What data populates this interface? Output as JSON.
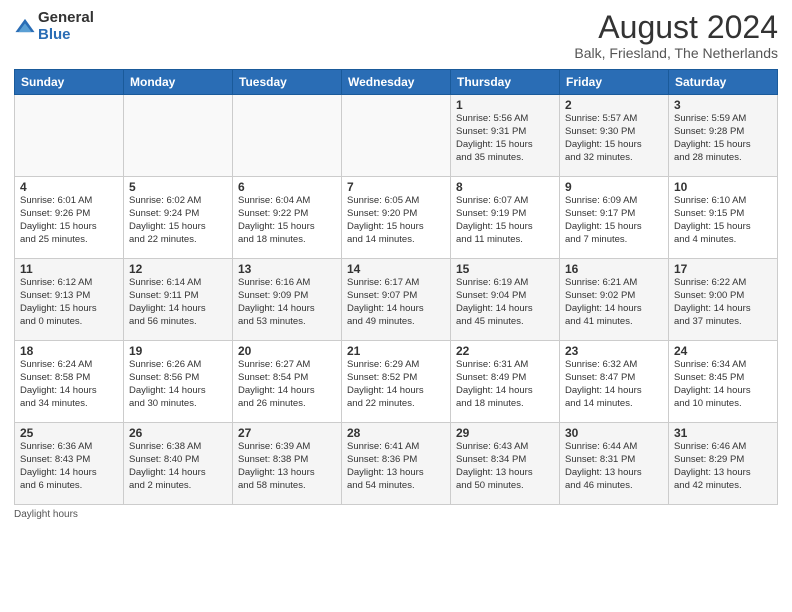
{
  "logo": {
    "general": "General",
    "blue": "Blue"
  },
  "header": {
    "month_year": "August 2024",
    "location": "Balk, Friesland, The Netherlands"
  },
  "days_of_week": [
    "Sunday",
    "Monday",
    "Tuesday",
    "Wednesday",
    "Thursday",
    "Friday",
    "Saturday"
  ],
  "weeks": [
    [
      {
        "day": "",
        "detail": ""
      },
      {
        "day": "",
        "detail": ""
      },
      {
        "day": "",
        "detail": ""
      },
      {
        "day": "",
        "detail": ""
      },
      {
        "day": "1",
        "detail": "Sunrise: 5:56 AM\nSunset: 9:31 PM\nDaylight: 15 hours\nand 35 minutes."
      },
      {
        "day": "2",
        "detail": "Sunrise: 5:57 AM\nSunset: 9:30 PM\nDaylight: 15 hours\nand 32 minutes."
      },
      {
        "day": "3",
        "detail": "Sunrise: 5:59 AM\nSunset: 9:28 PM\nDaylight: 15 hours\nand 28 minutes."
      }
    ],
    [
      {
        "day": "4",
        "detail": "Sunrise: 6:01 AM\nSunset: 9:26 PM\nDaylight: 15 hours\nand 25 minutes."
      },
      {
        "day": "5",
        "detail": "Sunrise: 6:02 AM\nSunset: 9:24 PM\nDaylight: 15 hours\nand 22 minutes."
      },
      {
        "day": "6",
        "detail": "Sunrise: 6:04 AM\nSunset: 9:22 PM\nDaylight: 15 hours\nand 18 minutes."
      },
      {
        "day": "7",
        "detail": "Sunrise: 6:05 AM\nSunset: 9:20 PM\nDaylight: 15 hours\nand 14 minutes."
      },
      {
        "day": "8",
        "detail": "Sunrise: 6:07 AM\nSunset: 9:19 PM\nDaylight: 15 hours\nand 11 minutes."
      },
      {
        "day": "9",
        "detail": "Sunrise: 6:09 AM\nSunset: 9:17 PM\nDaylight: 15 hours\nand 7 minutes."
      },
      {
        "day": "10",
        "detail": "Sunrise: 6:10 AM\nSunset: 9:15 PM\nDaylight: 15 hours\nand 4 minutes."
      }
    ],
    [
      {
        "day": "11",
        "detail": "Sunrise: 6:12 AM\nSunset: 9:13 PM\nDaylight: 15 hours\nand 0 minutes."
      },
      {
        "day": "12",
        "detail": "Sunrise: 6:14 AM\nSunset: 9:11 PM\nDaylight: 14 hours\nand 56 minutes."
      },
      {
        "day": "13",
        "detail": "Sunrise: 6:16 AM\nSunset: 9:09 PM\nDaylight: 14 hours\nand 53 minutes."
      },
      {
        "day": "14",
        "detail": "Sunrise: 6:17 AM\nSunset: 9:07 PM\nDaylight: 14 hours\nand 49 minutes."
      },
      {
        "day": "15",
        "detail": "Sunrise: 6:19 AM\nSunset: 9:04 PM\nDaylight: 14 hours\nand 45 minutes."
      },
      {
        "day": "16",
        "detail": "Sunrise: 6:21 AM\nSunset: 9:02 PM\nDaylight: 14 hours\nand 41 minutes."
      },
      {
        "day": "17",
        "detail": "Sunrise: 6:22 AM\nSunset: 9:00 PM\nDaylight: 14 hours\nand 37 minutes."
      }
    ],
    [
      {
        "day": "18",
        "detail": "Sunrise: 6:24 AM\nSunset: 8:58 PM\nDaylight: 14 hours\nand 34 minutes."
      },
      {
        "day": "19",
        "detail": "Sunrise: 6:26 AM\nSunset: 8:56 PM\nDaylight: 14 hours\nand 30 minutes."
      },
      {
        "day": "20",
        "detail": "Sunrise: 6:27 AM\nSunset: 8:54 PM\nDaylight: 14 hours\nand 26 minutes."
      },
      {
        "day": "21",
        "detail": "Sunrise: 6:29 AM\nSunset: 8:52 PM\nDaylight: 14 hours\nand 22 minutes."
      },
      {
        "day": "22",
        "detail": "Sunrise: 6:31 AM\nSunset: 8:49 PM\nDaylight: 14 hours\nand 18 minutes."
      },
      {
        "day": "23",
        "detail": "Sunrise: 6:32 AM\nSunset: 8:47 PM\nDaylight: 14 hours\nand 14 minutes."
      },
      {
        "day": "24",
        "detail": "Sunrise: 6:34 AM\nSunset: 8:45 PM\nDaylight: 14 hours\nand 10 minutes."
      }
    ],
    [
      {
        "day": "25",
        "detail": "Sunrise: 6:36 AM\nSunset: 8:43 PM\nDaylight: 14 hours\nand 6 minutes."
      },
      {
        "day": "26",
        "detail": "Sunrise: 6:38 AM\nSunset: 8:40 PM\nDaylight: 14 hours\nand 2 minutes."
      },
      {
        "day": "27",
        "detail": "Sunrise: 6:39 AM\nSunset: 8:38 PM\nDaylight: 13 hours\nand 58 minutes."
      },
      {
        "day": "28",
        "detail": "Sunrise: 6:41 AM\nSunset: 8:36 PM\nDaylight: 13 hours\nand 54 minutes."
      },
      {
        "day": "29",
        "detail": "Sunrise: 6:43 AM\nSunset: 8:34 PM\nDaylight: 13 hours\nand 50 minutes."
      },
      {
        "day": "30",
        "detail": "Sunrise: 6:44 AM\nSunset: 8:31 PM\nDaylight: 13 hours\nand 46 minutes."
      },
      {
        "day": "31",
        "detail": "Sunrise: 6:46 AM\nSunset: 8:29 PM\nDaylight: 13 hours\nand 42 minutes."
      }
    ]
  ],
  "footer": {
    "daylight_label": "Daylight hours"
  }
}
